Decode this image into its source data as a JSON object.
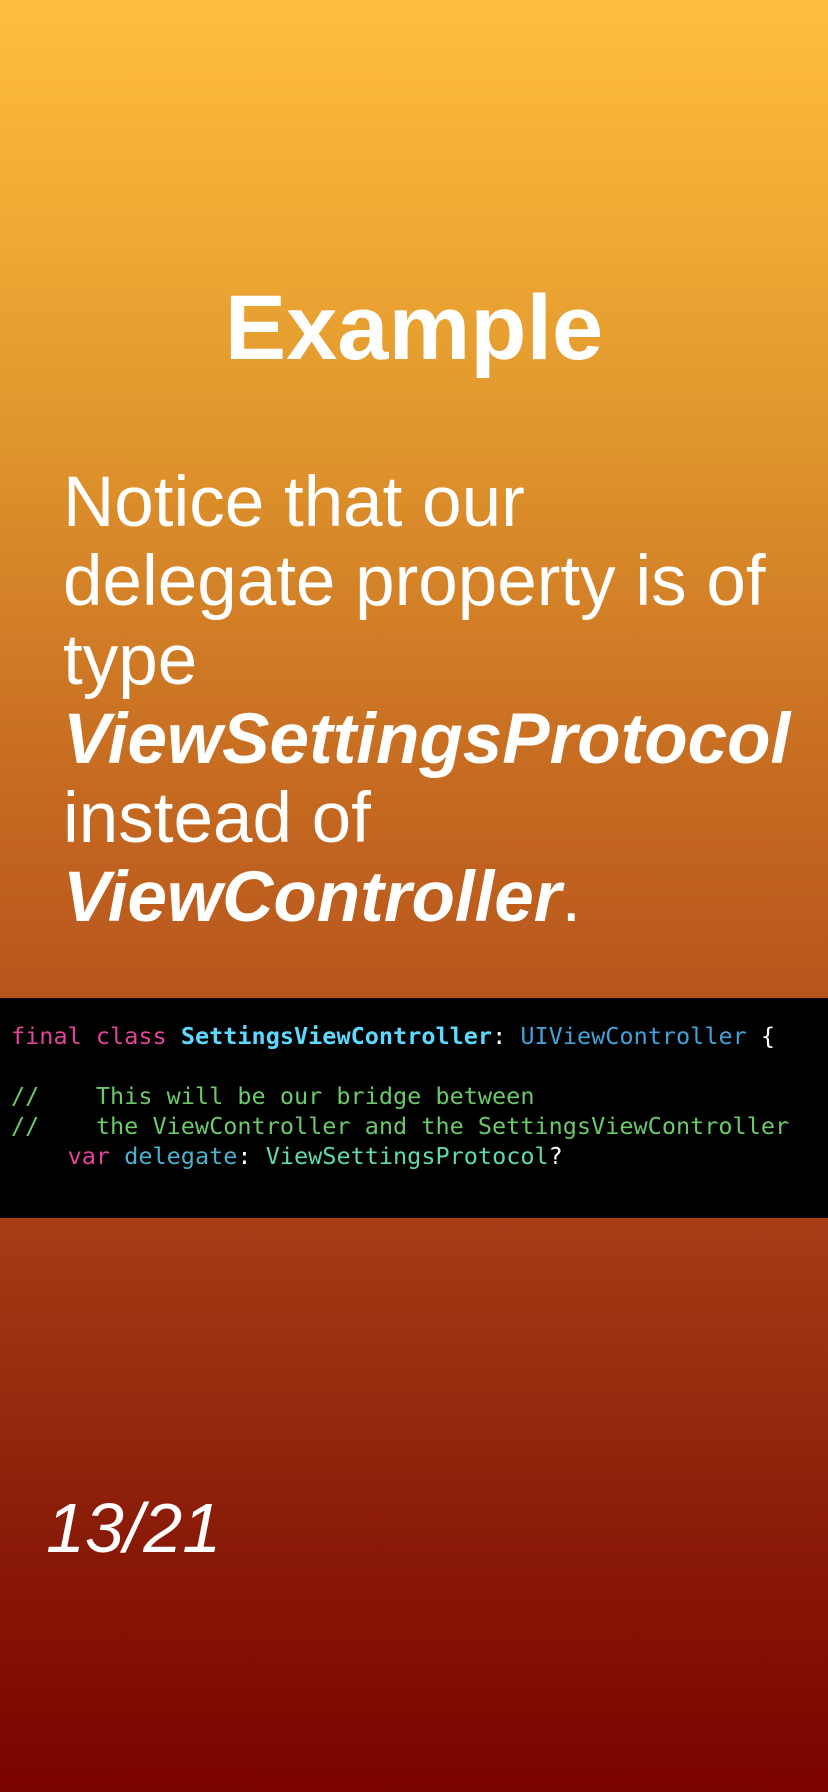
{
  "slide": {
    "title": "Example",
    "body": {
      "line1": "Notice that our",
      "line2": "delegate property is of",
      "line3": "type",
      "line4_emphasis": "ViewSettingsProtocol",
      "line5": "instead of",
      "line6_emphasis": "ViewController",
      "line6_suffix": "."
    },
    "page_counter": "13/21"
  },
  "code": {
    "line1": {
      "kw1": "final",
      "kw2": "class",
      "class_name": "SettingsViewController",
      "colon": ":",
      "superclass": "UIViewController",
      "brace": "{"
    },
    "comment1": "//    This will be our bridge between",
    "comment2": "//    the ViewController and the SettingsViewController",
    "line4": {
      "kw": "var",
      "prop": "delegate",
      "colon": ":",
      "type": "ViewSettingsProtocol",
      "optional": "?"
    }
  },
  "colors": {
    "background_top": "#FFBE3D",
    "background_bottom": "#7A0300",
    "code_background": "#000000",
    "keyword": "#E3439C",
    "type_name": "#5DD8FF",
    "superclass": "#41A1D8",
    "comment": "#6BC86B",
    "property": "#4EB0CC",
    "protocol_type": "#5FD9B2"
  }
}
